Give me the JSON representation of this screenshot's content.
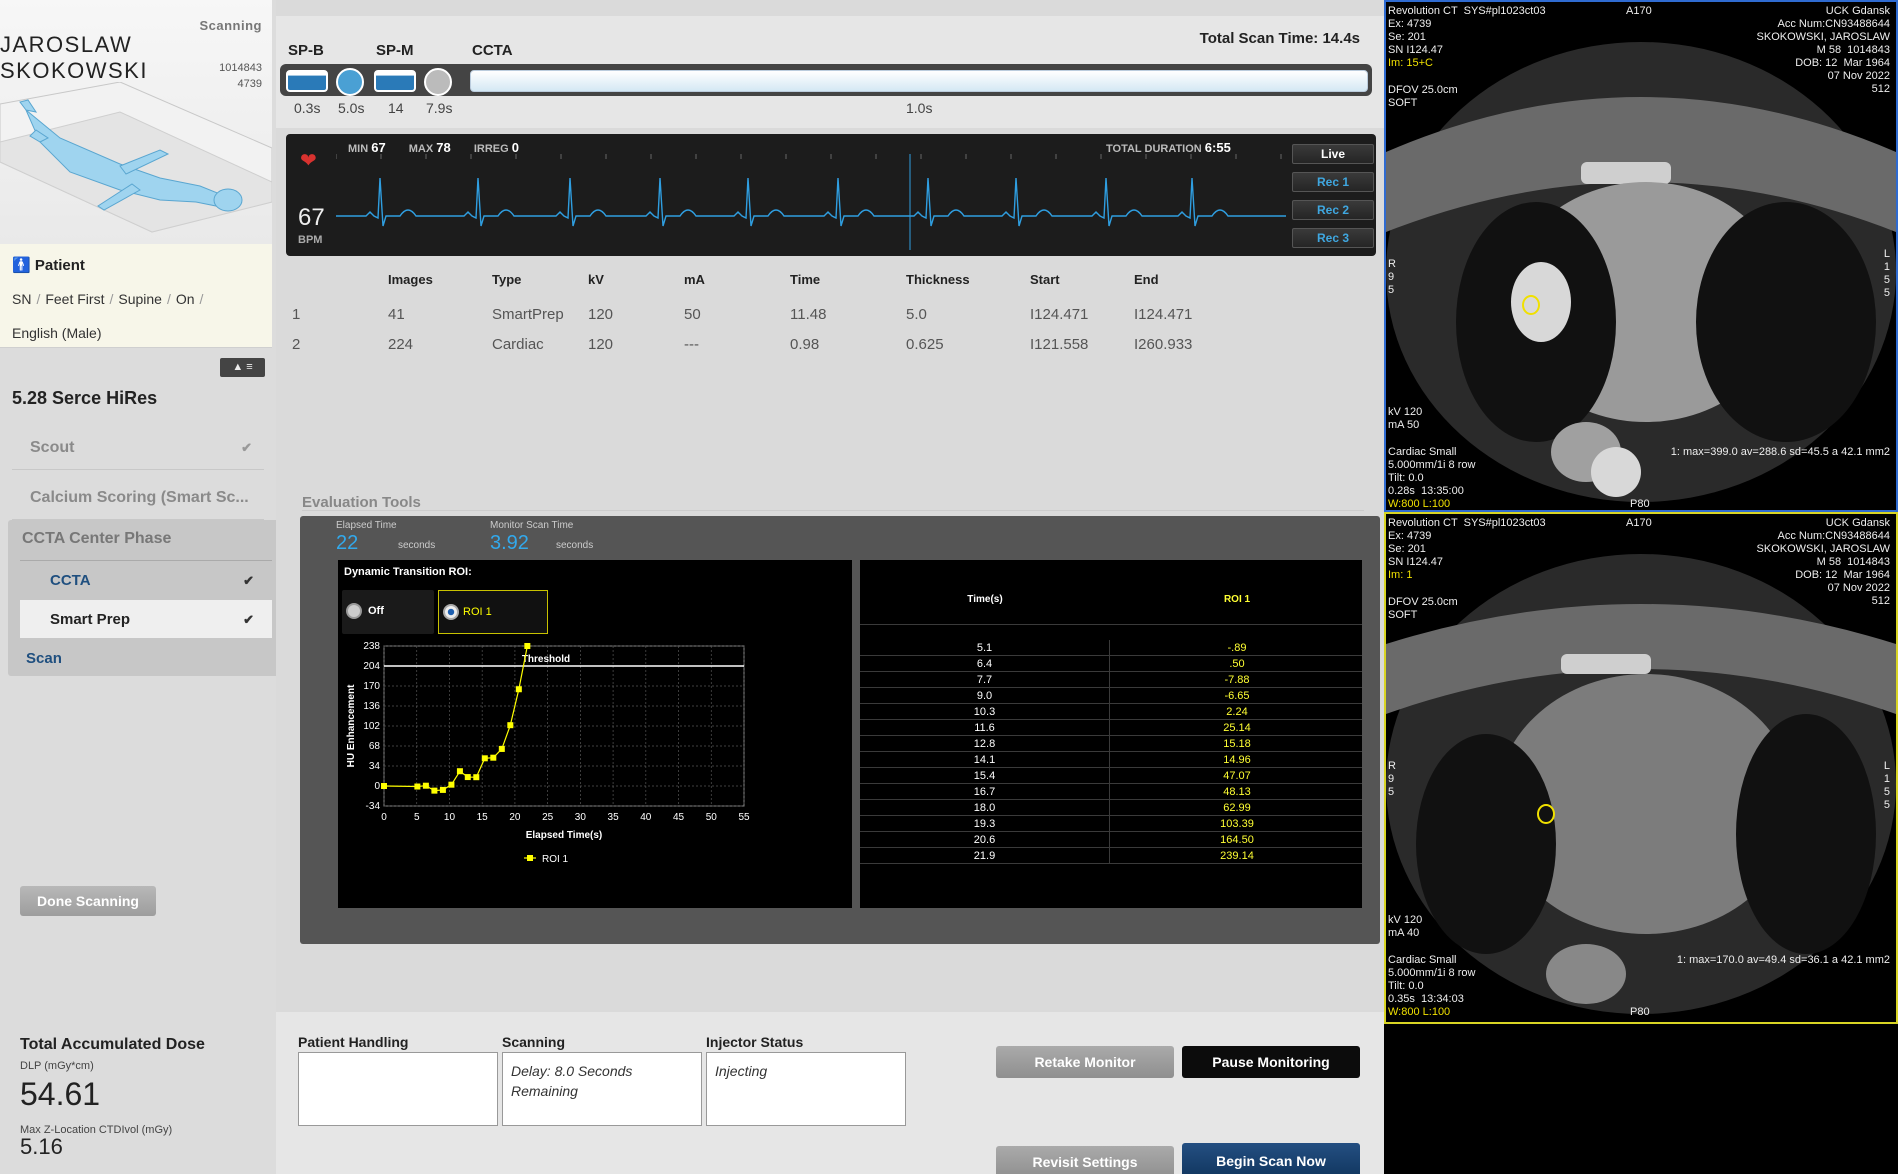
{
  "patient": {
    "scanning_label": "Scanning",
    "name": "JAROSLAW SKOKOWSKI",
    "id_line1": "1014843",
    "id_line2": "4739",
    "section_title": "Patient",
    "details": [
      "SN",
      "Feet First",
      "Supine",
      "On",
      "English (Male)"
    ]
  },
  "protocol": {
    "collapse_label": "▲ ≡",
    "title": "5.28 Serce HiRes",
    "items": [
      {
        "label": "Scout",
        "check": "✔"
      },
      {
        "label": "Calcium Scoring (Smart Sc...",
        "check": ""
      }
    ],
    "series_group": {
      "title": "CCTA Center Phase",
      "items": [
        {
          "label": "CCTA",
          "check": "✔"
        },
        {
          "label": "Smart Prep",
          "check": "✔"
        }
      ],
      "scan_link": "Scan"
    },
    "done_button": "Done Scanning"
  },
  "dose": {
    "title": "Total Accumulated Dose",
    "dlp_label": "DLP (mGy*cm)",
    "dlp_value": "54.61",
    "ctdi_label": "Max Z-Location CTDIvol (mGy)",
    "ctdi_value": "5.16"
  },
  "timeline": {
    "total_scan_time": "Total Scan Time: 14.4s",
    "stages": [
      "SP-B",
      "SP-M",
      "CCTA"
    ],
    "times": [
      "0.3s",
      "5.0s",
      "14",
      "7.9s",
      "1.0s"
    ]
  },
  "ecg": {
    "bpm": "67",
    "bpm_label": "BPM",
    "min_label": "MIN",
    "min": "67",
    "max_label": "MAX",
    "max": "78",
    "irreg_label": "IRREG",
    "irreg": "0",
    "duration_label": "TOTAL DURATION",
    "duration": "6:55",
    "buttons": [
      "Live",
      "Rec 1",
      "Rec 2",
      "Rec 3"
    ],
    "trace_color": "#2f9ee0"
  },
  "series_table": {
    "headers": [
      "Images",
      "Type",
      "kV",
      "mA",
      "Time",
      "Thickness",
      "Start",
      "End"
    ],
    "rows": [
      [
        "1",
        "41",
        "SmartPrep",
        "120",
        "50",
        "11.48",
        "5.0",
        "I124.471",
        "I124.471"
      ],
      [
        "2",
        "224",
        "Cardiac",
        "120",
        "---",
        "0.98",
        "0.625",
        "I121.558",
        "I260.933"
      ]
    ]
  },
  "evaluation": {
    "title": "Evaluation Tools",
    "elapsed_label": "Elapsed Time",
    "elapsed_value": "22",
    "elapsed_unit": "seconds",
    "monitor_label": "Monitor Scan Time",
    "monitor_value": "3.92",
    "monitor_unit": "seconds",
    "roi_title": "Dynamic Transition ROI:",
    "roi_off": "Off",
    "roi_1": "ROI 1",
    "table_header_time": "Time(s)",
    "table_header_roi": "ROI 1",
    "table_rows": [
      [
        "5.1",
        "-.89"
      ],
      [
        "6.4",
        ".50"
      ],
      [
        "7.7",
        "-7.88"
      ],
      [
        "9.0",
        "-6.65"
      ],
      [
        "10.3",
        "2.24"
      ],
      [
        "11.6",
        "25.14"
      ],
      [
        "12.8",
        "15.18"
      ],
      [
        "14.1",
        "14.96"
      ],
      [
        "15.4",
        "47.07"
      ],
      [
        "16.7",
        "48.13"
      ],
      [
        "18.0",
        "62.99"
      ],
      [
        "19.3",
        "103.39"
      ],
      [
        "20.6",
        "164.50"
      ],
      [
        "21.9",
        "239.14"
      ]
    ]
  },
  "chart_data": {
    "type": "line",
    "xlabel": "Elapsed Time(s)",
    "ylabel": "HU Enhancement",
    "xlim": [
      0,
      55
    ],
    "ylim": [
      -34,
      238
    ],
    "x_ticks": [
      0,
      5,
      10,
      15,
      20,
      25,
      30,
      35,
      40,
      45,
      50,
      55
    ],
    "y_ticks": [
      -34,
      0,
      34,
      68,
      102,
      136,
      170,
      204,
      238
    ],
    "threshold": {
      "label": "Threshold",
      "value": 204
    },
    "grid": true,
    "legend_position": "bottom",
    "series": [
      {
        "name": "ROI 1",
        "color": "#ffff00",
        "x": [
          0,
          5.1,
          6.4,
          7.7,
          9.0,
          10.3,
          11.6,
          12.8,
          14.1,
          15.4,
          16.7,
          18.0,
          19.3,
          20.6,
          21.9
        ],
        "y": [
          0,
          -0.89,
          0.5,
          -7.88,
          -6.65,
          2.24,
          25.14,
          15.18,
          14.96,
          47.07,
          48.13,
          62.99,
          103.39,
          164.5,
          239.14
        ]
      }
    ]
  },
  "status": {
    "patient_handling_label": "Patient Handling",
    "patient_handling_text": "",
    "scanning_label": "Scanning",
    "scanning_text": "Delay: 8.0 Seconds Remaining",
    "injector_label": "Injector Status",
    "injector_text": "Injecting",
    "retake_button": "Retake Monitor",
    "pause_button": "Pause Monitoring",
    "revisit_button": "Revisit Settings",
    "begin_button": "Begin Scan Now"
  },
  "viewports": [
    {
      "tl": "Revolution CT  SYS#pl1023ct03\nEx: 4739\nSe: 201\nSN I124.47",
      "tl_yellow": "Im: 15+C",
      "tl2": "DFOV 25.0cm\nSOFT",
      "tc": "A170",
      "tr": "UCK Gdansk\nAcc Num:CN93488644\nSKOKOWSKI, JAROSLAW\nM 58  1014843\nDOB: 12  Mar 1964\n07 Nov 2022\n512",
      "left_orient": "R\n9\n5",
      "right_orient": "L\n1\n5\n5",
      "bl": "kV 120\nmA 50",
      "bl2": "Cardiac Small\n5.000mm/1i 8 row\nTilt: 0.0\n0.28s  13:35:00",
      "bl_yellow": "W:800 L:100",
      "br": "1: max=399.0 av=288.6 sd=45.5 a 42.1 mm2",
      "bc": "P80"
    },
    {
      "tl": "Revolution CT  SYS#pl1023ct03\nEx: 4739\nSe: 201\nSN I124.47",
      "tl_yellow": "Im: 1",
      "tl2": "DFOV 25.0cm\nSOFT",
      "tc": "A170",
      "tr": "UCK Gdansk\nAcc Num:CN93488644\nSKOKOWSKI, JAROSLAW\nM 58  1014843\nDOB: 12  Mar 1964\n07 Nov 2022\n512",
      "left_orient": "R\n9\n5",
      "right_orient": "L\n1\n5\n5",
      "bl": "kV 120\nmA 40",
      "bl2": "Cardiac Small\n5.000mm/1i 8 row\nTilt: 0.0\n0.35s  13:34:03",
      "bl_yellow": "W:800 L:100",
      "br": "1: max=170.0 av=49.4 sd=36.1 a 42.1 mm2",
      "bc": "P80"
    }
  ]
}
